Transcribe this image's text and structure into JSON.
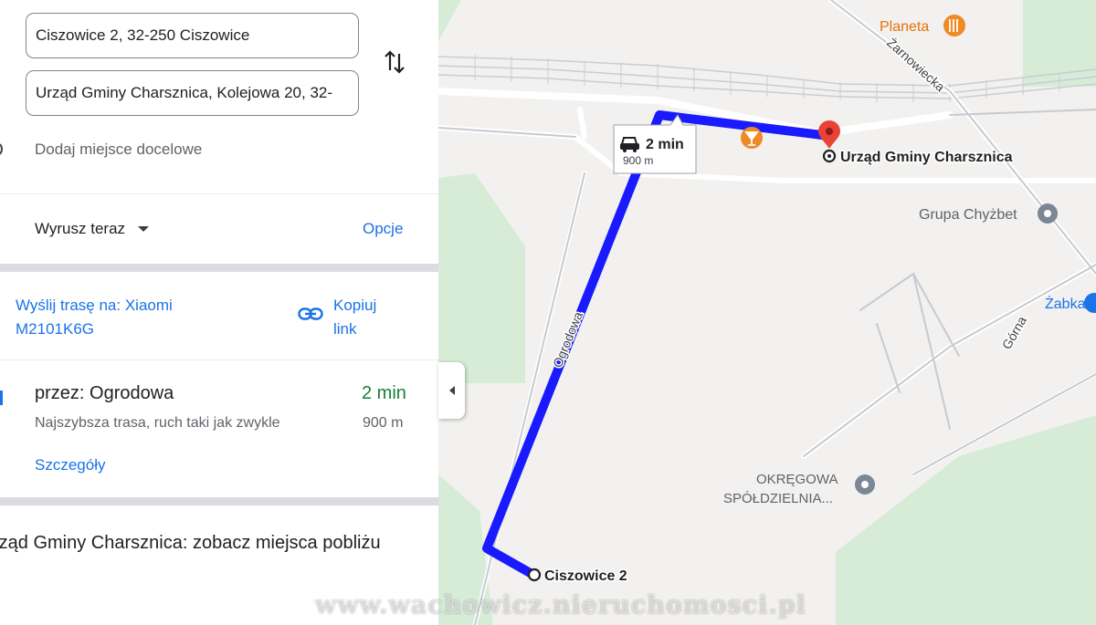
{
  "directions": {
    "origin": "Ciszowice 2, 32-250 Ciszowice",
    "destination": "Urząd Gminy Charsznica, Kolejowa 20, 32-",
    "add_destination": "Dodaj miejsce docelowe",
    "swap_icon": "swap-vertical-icon"
  },
  "depart": {
    "label": "Wyrusz teraz",
    "options": "Opcje"
  },
  "send": {
    "label": "Wyślij trasę na: Xiaomi M2101K6G",
    "copy_label": "Kopiuj link"
  },
  "route": {
    "via": "przez: Ogrodowa",
    "time": "2 min",
    "description": "Najszybsza trasa, ruch taki jak zwykle",
    "distance": "900 m",
    "details": "Szczegóły"
  },
  "nearby": "rząd Gminy Charsznica: zobacz miejsca pobliżu",
  "map": {
    "bubble_time": "2 min",
    "bubble_distance": "900 m",
    "destination_label": "Urząd Gminy Charsznica",
    "origin_label": "Ciszowice 2",
    "streets": {
      "ogrodowa": "Ogrodowa",
      "zarnowiecka": "Żarnowiecka",
      "gorna": "Górna"
    },
    "pois": {
      "planeta": "Planeta",
      "grupa": "Grupa Chyżbet",
      "zabka": "Żabka",
      "okregowa_1": "OKRĘGOWA",
      "okregowa_2": "SPÓŁDZIELNIA..."
    },
    "colors": {
      "route": "#1a1aff",
      "pin": "#ea4335",
      "park": "#d6ecd6",
      "poi_orange": "#f08a24"
    }
  },
  "watermark": "www.wachowicz.nieruchomosci.pl"
}
